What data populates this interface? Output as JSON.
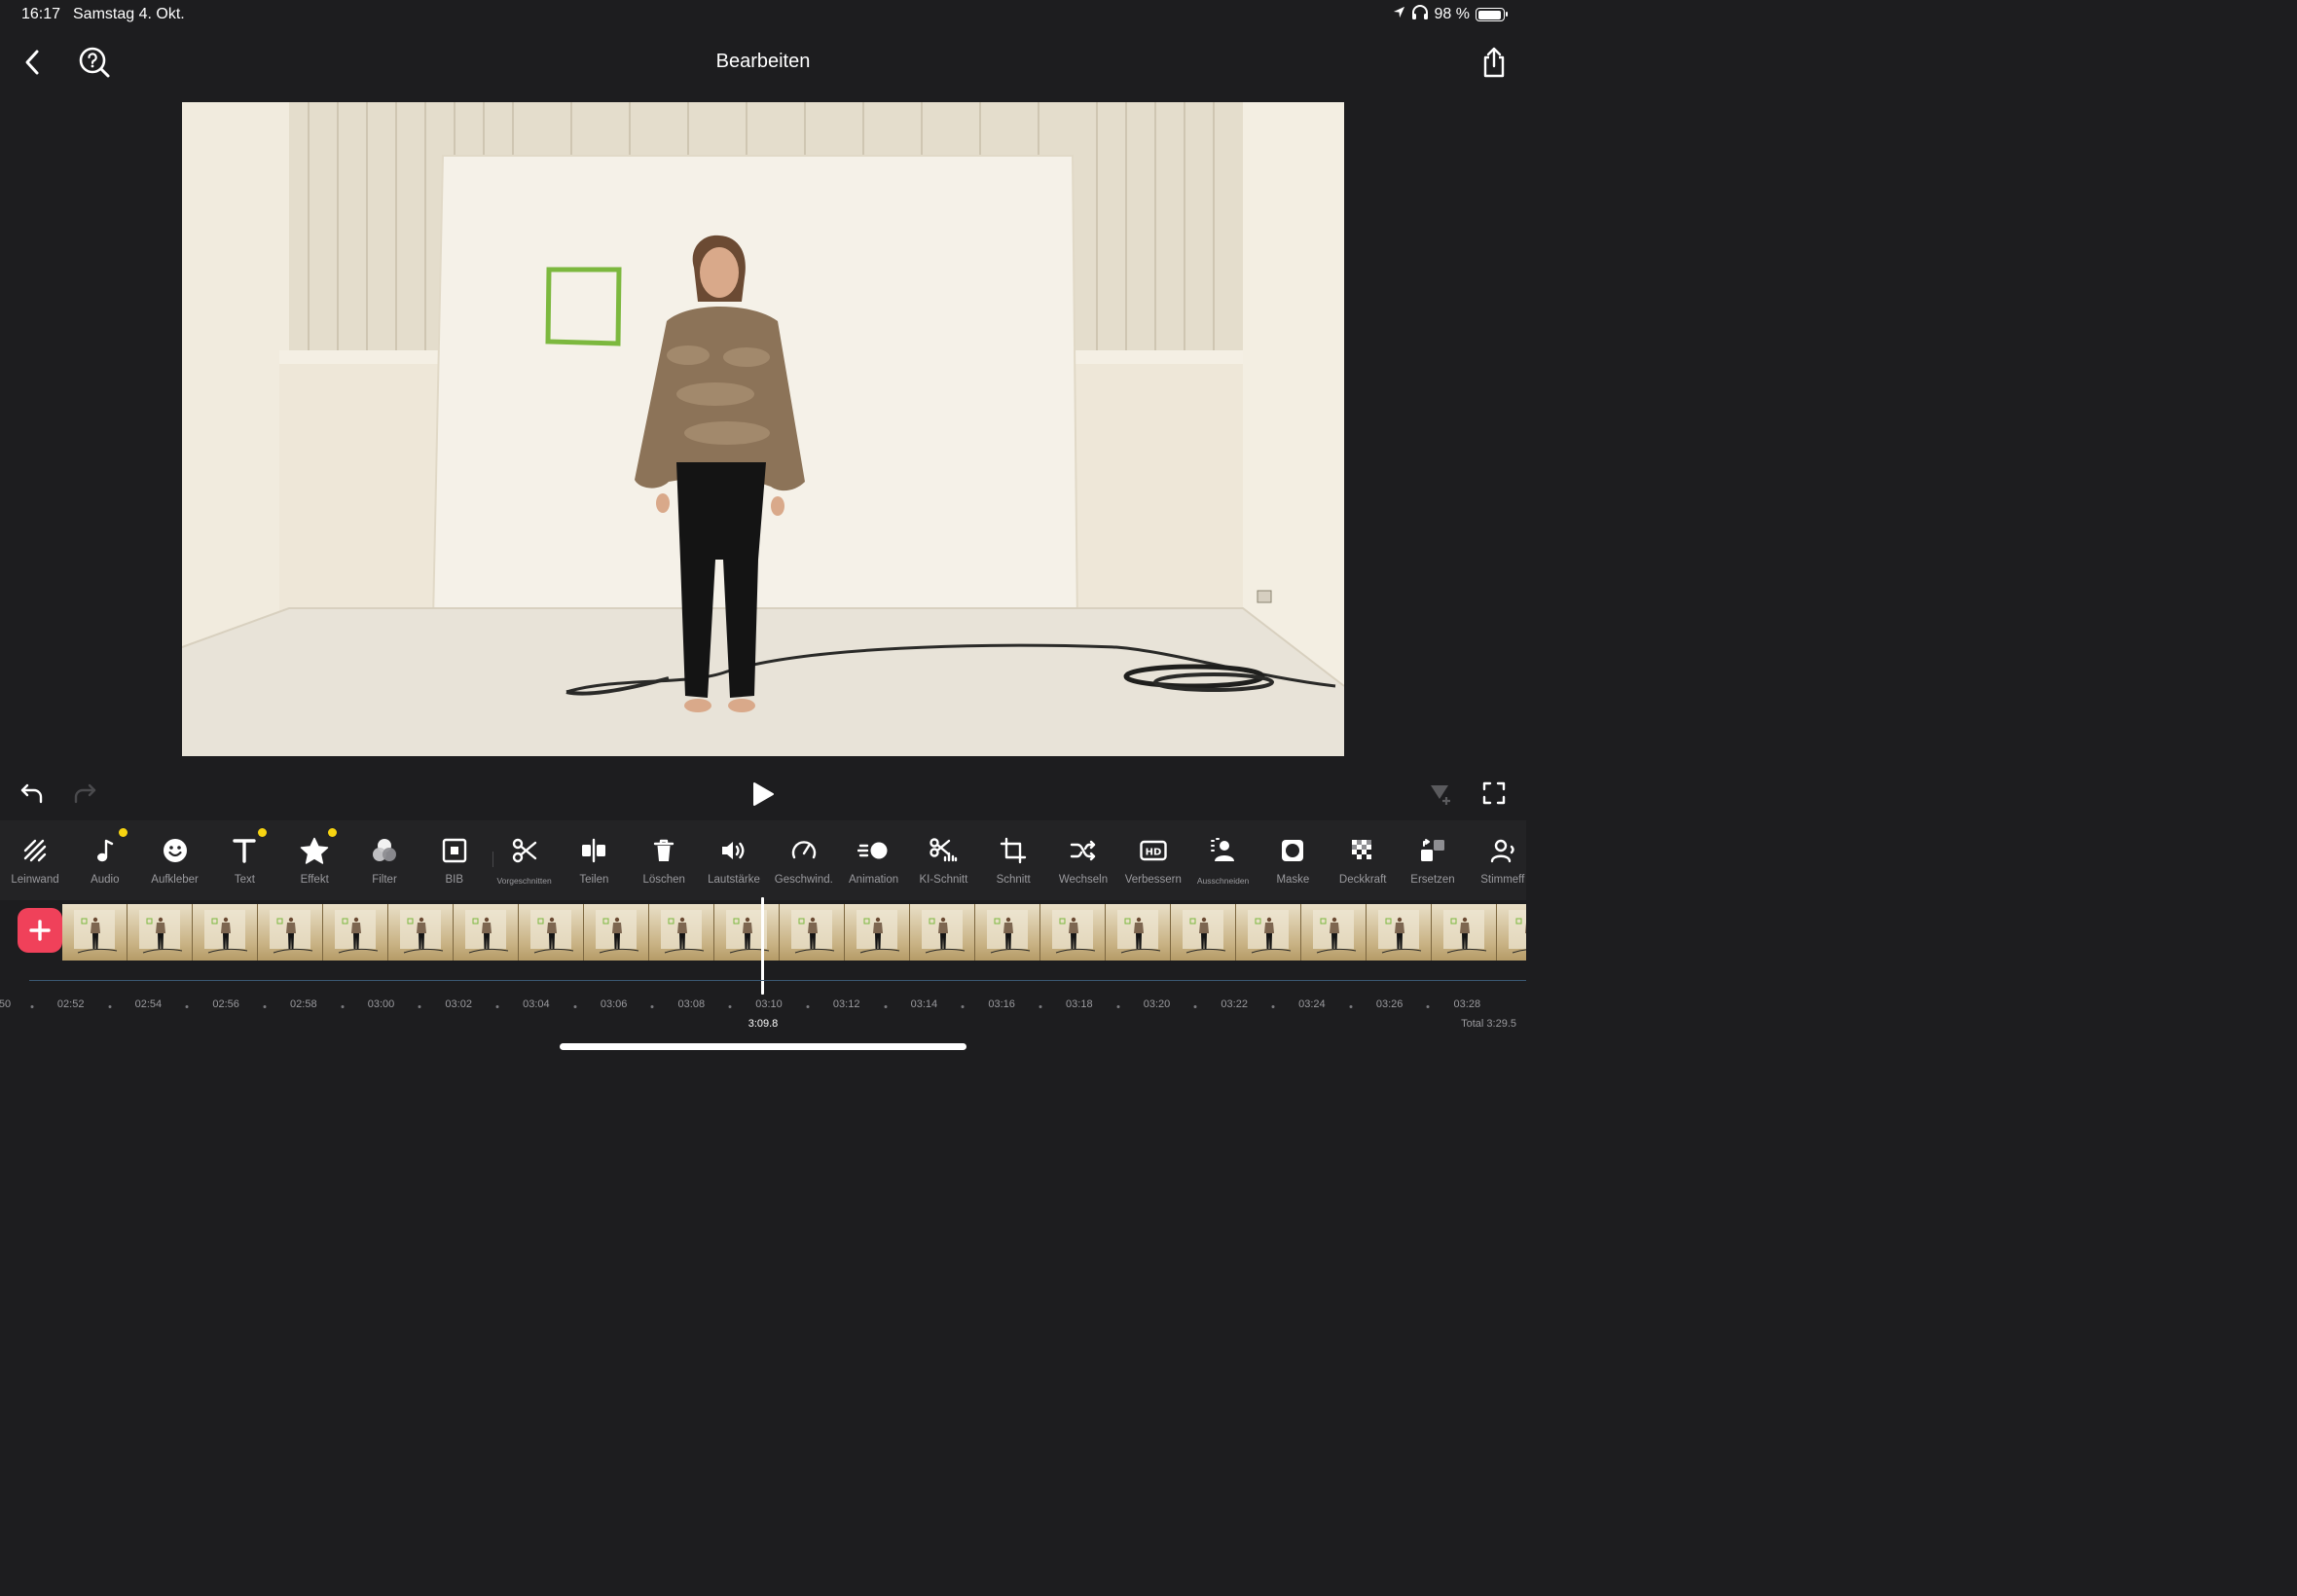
{
  "status_bar": {
    "time": "16:17",
    "date": "Samstag 4. Okt.",
    "battery_text": "98 %",
    "battery_level": 0.98,
    "icons": [
      "location-arrow-icon",
      "headphones-icon",
      "battery-icon"
    ]
  },
  "header": {
    "title": "Bearbeiten",
    "left_icons": [
      "back-chevron-icon",
      "help-search-icon"
    ],
    "right_icon": "share-icon"
  },
  "preview": {
    "description_icon": "video-frame",
    "colors": {
      "wall": "#efe9db",
      "floor": "#e9e4da",
      "panel": "#f3efe6",
      "green_frame": "#7cb83e"
    }
  },
  "playback": {
    "icons": [
      "undo-icon",
      "redo-icon",
      "play-icon",
      "add-keyframe-icon",
      "fullscreen-icon"
    ]
  },
  "toolbar": {
    "items": [
      {
        "label": "Leinwand",
        "icon": "canvas-icon",
        "dot": false
      },
      {
        "label": "Audio",
        "icon": "music-note-icon",
        "dot": true
      },
      {
        "label": "Aufkleber",
        "icon": "sticker-icon",
        "dot": false
      },
      {
        "label": "Text",
        "icon": "text-icon",
        "dot": true
      },
      {
        "label": "Effekt",
        "icon": "star-icon",
        "dot": true
      },
      {
        "label": "Filter",
        "icon": "filter-icon",
        "dot": false
      },
      {
        "label": "BIB",
        "icon": "picture-in-picture-icon",
        "dot": false
      },
      {
        "label": "Vorgeschnitten",
        "icon": "scissors-icon",
        "dot": false,
        "small": true
      },
      {
        "label": "Teilen",
        "icon": "split-icon",
        "dot": false
      },
      {
        "label": "Löschen",
        "icon": "trash-icon",
        "dot": false
      },
      {
        "label": "Lautstärke",
        "icon": "volume-icon",
        "dot": false
      },
      {
        "label": "Geschwind.",
        "icon": "speedometer-icon",
        "dot": false
      },
      {
        "label": "Animation",
        "icon": "animation-icon",
        "dot": false
      },
      {
        "label": "KI-Schnitt",
        "icon": "ai-cut-icon",
        "dot": false
      },
      {
        "label": "Schnitt",
        "icon": "crop-icon",
        "dot": false
      },
      {
        "label": "Wechseln",
        "icon": "shuffle-icon",
        "dot": false
      },
      {
        "label": "Verbessern",
        "icon": "hd-icon",
        "dot": false
      },
      {
        "label": "Ausschneiden",
        "icon": "person-cutout-icon",
        "dot": false,
        "small": true
      },
      {
        "label": "Maske",
        "icon": "mask-icon",
        "dot": false
      },
      {
        "label": "Deckkraft",
        "icon": "opacity-icon",
        "dot": false
      },
      {
        "label": "Ersetzen",
        "icon": "replace-icon",
        "dot": false
      },
      {
        "label": "Stimmeff",
        "icon": "voice-effect-icon",
        "dot": false
      }
    ]
  },
  "timeline": {
    "add_button_icon": "plus-icon",
    "thumbnail_count": 23,
    "ruler_ticks": [
      "50",
      "02:52",
      "02:54",
      "02:56",
      "02:58",
      "03:00",
      "03:02",
      "03:04",
      "03:06",
      "03:08",
      "03:10",
      "03:12",
      "03:14",
      "03:16",
      "03:18",
      "03:20",
      "03:22",
      "03:24",
      "03:26",
      "03:28"
    ],
    "current_time": "3:09.8",
    "total_time": "Total 3:29.5"
  }
}
